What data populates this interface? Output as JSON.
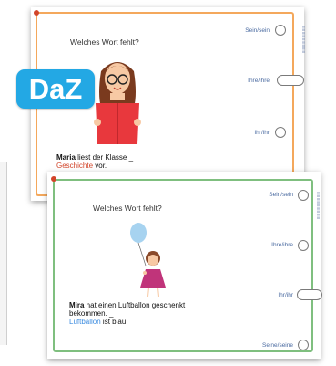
{
  "badge": {
    "label": "DaZ"
  },
  "card1": {
    "question": "Welches Wort fehlt?",
    "options": [
      "Sein/sein",
      "Ihre/ihre",
      "Ihr/ihr"
    ],
    "sentence_name": "Maria",
    "sentence_part1": " liest der Klasse _",
    "sentence_highlight": "Geschichte",
    "sentence_part2": " vor.",
    "colors": {
      "frame": "#f4a85c",
      "accent": "#d2452a"
    }
  },
  "card2": {
    "question": "Welches Wort fehlt?",
    "options": [
      "Sein/sein",
      "Ihre/ihre",
      "Ihr/ihr",
      "Seine/seine"
    ],
    "sentence_name": "Mira",
    "sentence_part1": " hat einen Luftballon geschenkt bekommen. _",
    "sentence_highlight": "Luftballon",
    "sentence_part2": " ist blau.",
    "colors": {
      "frame": "#7fbf7f",
      "accent": "#3d8de0"
    }
  }
}
